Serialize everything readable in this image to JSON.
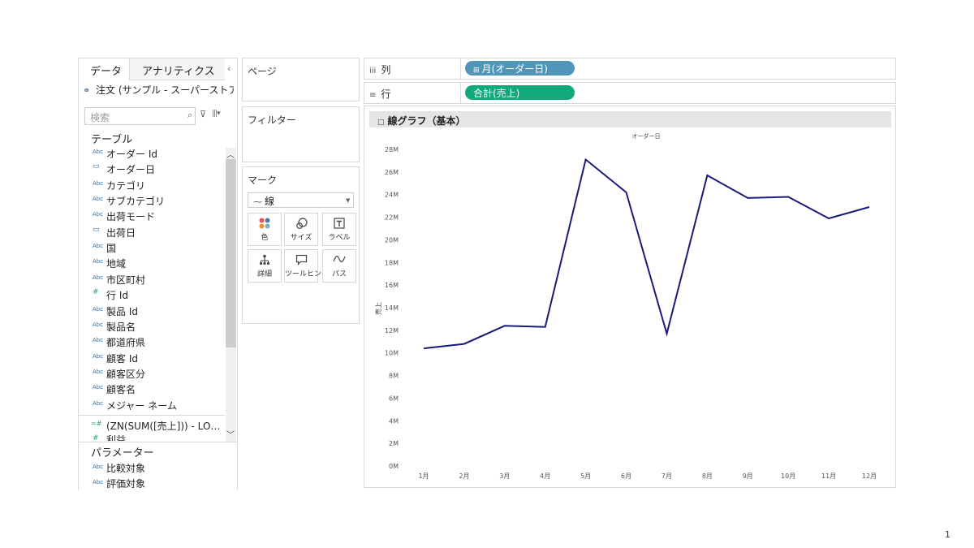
{
  "left_pane": {
    "tabs": [
      "データ",
      "アナリティクス"
    ],
    "collapse_icon": "chevron-left-icon",
    "datasource": "注文 (サンプル - スーパーストア…",
    "search_placeholder": "検索",
    "tables_header": "テーブル",
    "fields": [
      {
        "type": "Abc",
        "name": "オーダー Id"
      },
      {
        "type": "date",
        "name": "オーダー日"
      },
      {
        "type": "Abc",
        "name": "カテゴリ"
      },
      {
        "type": "Abc",
        "name": "サブカテゴリ"
      },
      {
        "type": "Abc",
        "name": "出荷モード"
      },
      {
        "type": "date",
        "name": "出荷日"
      },
      {
        "type": "Abc",
        "name": "国"
      },
      {
        "type": "Abc",
        "name": "地域"
      },
      {
        "type": "Abc",
        "name": "市区町村"
      },
      {
        "type": "#",
        "name": "行 Id"
      },
      {
        "type": "Abc",
        "name": "製品 Id"
      },
      {
        "type": "Abc",
        "name": "製品名"
      },
      {
        "type": "Abc",
        "name": "都道府県"
      },
      {
        "type": "Abc",
        "name": "顧客 Id"
      },
      {
        "type": "Abc",
        "name": "顧客区分"
      },
      {
        "type": "Abc",
        "name": "顧客名"
      },
      {
        "type": "Abc",
        "name": "メジャー ネーム"
      }
    ],
    "calc_field": {
      "type": "=#",
      "name": "(ZN(SUM([売上])) - LO…"
    },
    "partial_field": {
      "type": "#",
      "name": "利益"
    },
    "params_header": "パラメーター",
    "params": [
      {
        "type": "Abc",
        "name": "比較対象"
      },
      {
        "type": "Abc",
        "name": "評価対象"
      }
    ]
  },
  "cards": {
    "pages": "ページ",
    "filters": "フィルター",
    "marks": "マーク",
    "mark_type": "線",
    "mark_buttons": [
      {
        "icon": "color-dots-icon",
        "label": "色"
      },
      {
        "icon": "size-icon",
        "label": "サイズ"
      },
      {
        "icon": "label-icon",
        "label": "ラベル"
      },
      {
        "icon": "detail-icon",
        "label": "詳細"
      },
      {
        "icon": "tooltip-icon",
        "label": "ツールヒント"
      },
      {
        "icon": "path-icon",
        "label": "パス"
      }
    ]
  },
  "shelves": {
    "columns_label": "列",
    "columns_pill": "月(オーダー日)",
    "rows_label": "行",
    "rows_pill": "合計(売上)",
    "column_pill_color": "#4f96b8",
    "row_pill_color": "#11a979"
  },
  "sheet": {
    "title": "線グラフ（基本）"
  },
  "chart_data": {
    "type": "line",
    "title": "オーダー日",
    "xlabel": "",
    "ylabel": "売上",
    "categories": [
      "1月",
      "2月",
      "3月",
      "4月",
      "5月",
      "6月",
      "7月",
      "8月",
      "9月",
      "10月",
      "11月",
      "12月"
    ],
    "values": [
      10.4,
      10.8,
      12.4,
      12.3,
      27.1,
      24.2,
      11.7,
      25.7,
      23.7,
      23.8,
      21.9,
      22.9
    ],
    "unit": "M",
    "y_ticks": [
      "0M",
      "2M",
      "4M",
      "6M",
      "8M",
      "10M",
      "12M",
      "14M",
      "16M",
      "18M",
      "20M",
      "22M",
      "24M",
      "26M",
      "28M"
    ],
    "ylim": [
      0,
      28
    ],
    "grid": false,
    "line_color": "#1a1a7a"
  },
  "page_number": "1"
}
